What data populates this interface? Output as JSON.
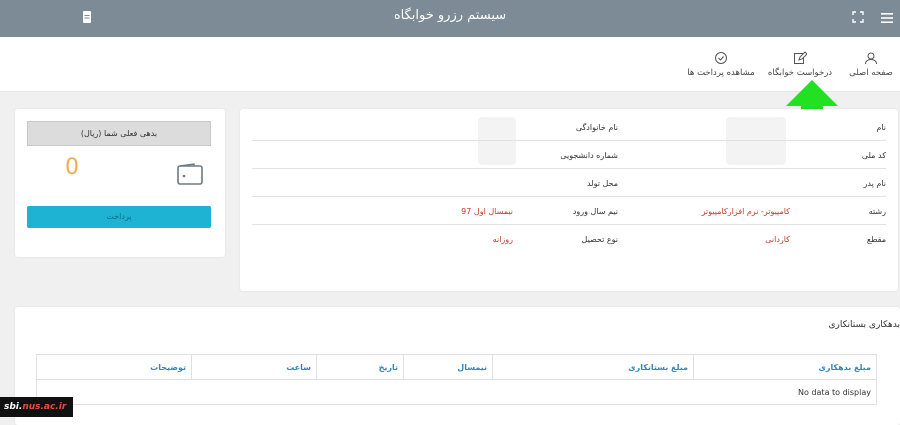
{
  "header": {
    "title": "سیستم رزرو خوابگاه"
  },
  "nav": {
    "home": "صفحه اصلی",
    "dorm_request": "درخواست خوابگاه",
    "payments": "مشاهده پرداخت ها"
  },
  "wallet": {
    "debt_label": "بدهی فعلی شما (ریال)",
    "balance": "0",
    "pay_button": "پرداخت"
  },
  "student_info": {
    "first_name_label": "نام",
    "last_name_label": "نام خانوادگی",
    "national_code_label": "کد ملی",
    "student_number_label": "شماره دانشجویی",
    "father_name_label": "نام پدر",
    "birth_place_label": "محل تولد",
    "field_label": "رشته",
    "field_value": "کامپیوتر- نرم افزارکامپیوتر",
    "entry_term_label": "نیم سال ورود",
    "entry_term_value": "نیمسال اول 97",
    "degree_label": "مقطع",
    "degree_value": "کاردانی",
    "study_type_label": "نوع تحصیل",
    "study_type_value": "روزانه"
  },
  "debts": {
    "title": "بدهکاری بستانکاری",
    "columns": [
      "مبلغ بدهکاری",
      "مبلغ بستانکاری",
      "نیمسال",
      "تاریخ",
      "ساعت",
      "توضیحات"
    ],
    "empty_text": "No data to display"
  },
  "watermark": {
    "prefix": "sbi.",
    "domain": "nus.ac.ir"
  },
  "colors": {
    "topbar": "#7c8b95",
    "accent": "#1fb3d3",
    "balance": "#f0ad4e",
    "value_red": "#c0392b",
    "arrow_green": "#22e022"
  }
}
